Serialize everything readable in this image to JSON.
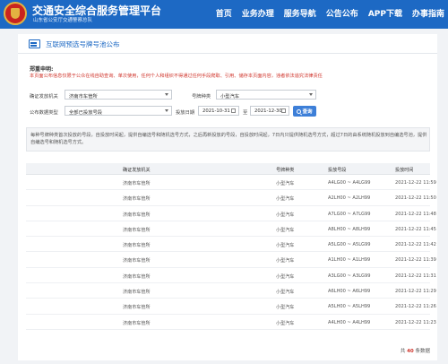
{
  "header": {
    "title": "交通安全综合服务管理平台",
    "subtitle": "山东省公安厅交通警察总队",
    "nav": [
      "首页",
      "业务办理",
      "服务导航",
      "公告公布",
      "APP下载",
      "办事指南"
    ],
    "bg_color": "#1d69c4"
  },
  "panel": {
    "title": "互联网预选号牌号池公布",
    "notice_title": "郑重申明:",
    "notice_text": "本页面公布信息仅限于公众在线自助查询、单次使用，任何个人和组织不得通过任何手段爬取、引用、储存本页面内容，违者依法追究法律责任"
  },
  "form": {
    "agency_label": "确证发放机关",
    "agency_value": "济南市车管所",
    "plate_type_label": "号牌种类",
    "plate_type_value": "小型汽车",
    "status_label": "公布数据类型",
    "status_value": "全部已投放号段",
    "date_label": "投放日期",
    "date_from": "2021-10-31",
    "date_sep": "至",
    "date_to": "2021-12-30",
    "query_label": "查询"
  },
  "info": "每种号牌种类首次投放的号段，自投放时间起，提供自编选号和随机选号方式，之后再新投放的号段，自投放时间起，7日内只提供随机选号方式，超过7日的由系统随机投放到自编选号池，提供自编选号和随机选号方式。",
  "table": {
    "headers": [
      "确证发放机关",
      "号牌种类",
      "投放号段",
      "投放时间"
    ],
    "rows": [
      [
        "济南市车管所",
        "小型汽车",
        "A4LG00 ~ A4LG99",
        "2021-12-22 11:59"
      ],
      [
        "济南市车管所",
        "小型汽车",
        "A2LH00 ~ A2LH99",
        "2021-12-22 11:50"
      ],
      [
        "济南市车管所",
        "小型汽车",
        "A7LG00 ~ A7LG99",
        "2021-12-22 11:48"
      ],
      [
        "济南市车管所",
        "小型汽车",
        "A8LH00 ~ A8LH99",
        "2021-12-22 11:45"
      ],
      [
        "济南市车管所",
        "小型汽车",
        "A5LG00 ~ A5LG99",
        "2021-12-22 11:42"
      ],
      [
        "济南市车管所",
        "小型汽车",
        "A1LH00 ~ A1LH99",
        "2021-12-22 11:39"
      ],
      [
        "济南市车管所",
        "小型汽车",
        "A3LG00 ~ A3LG99",
        "2021-12-22 11:31"
      ],
      [
        "济南市车管所",
        "小型汽车",
        "A6LH00 ~ A6LH99",
        "2021-12-22 11:29"
      ],
      [
        "济南市车管所",
        "小型汽车",
        "A5LH00 ~ A5LH99",
        "2021-12-22 11:26"
      ],
      [
        "济南市车管所",
        "小型汽车",
        "A4LH00 ~ A4LH99",
        "2021-12-22 11:23"
      ]
    ]
  },
  "footer": {
    "prefix": "共",
    "count": "40",
    "suffix": "条数据"
  }
}
